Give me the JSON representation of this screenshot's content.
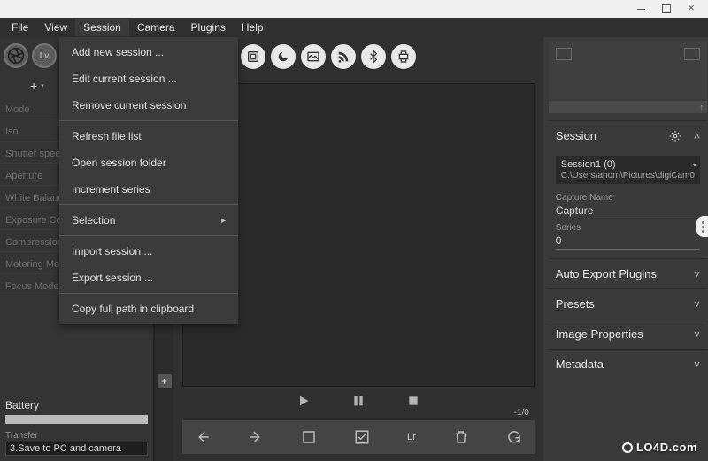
{
  "menubar": {
    "items": [
      "File",
      "View",
      "Session",
      "Camera",
      "Plugins",
      "Help"
    ],
    "active_index": 2
  },
  "dropdown": {
    "groups": [
      [
        "Add new session ...",
        "Edit current session ...",
        "Remove current session"
      ],
      [
        "Refresh file list",
        "Open session folder",
        "Increment series"
      ],
      [
        {
          "label": "Selection",
          "submenu": true
        }
      ],
      [
        "Import session ...",
        "Export session ..."
      ],
      [
        "Copy full path in clipboard"
      ]
    ]
  },
  "sidebar": {
    "lv_label": "Lv",
    "plus": "+",
    "settings": [
      {
        "label": "Mode"
      },
      {
        "label": "Iso"
      },
      {
        "label": "Shutter speed"
      },
      {
        "label": "Aperture"
      },
      {
        "label": "White Balance"
      },
      {
        "label": "Exposure Co"
      },
      {
        "label": "Compression"
      },
      {
        "label": "Metering Mode"
      },
      {
        "label": "Focus Mode"
      }
    ],
    "battery_label": "Battery",
    "transfer_label": "Transfer",
    "transfer_value": "3.Save to PC and camera"
  },
  "playback": {
    "counter": "-1/0"
  },
  "bottom": {
    "lr": "Lr"
  },
  "right": {
    "session_header": "Session",
    "session_name": "Session1",
    "session_count": "(0)",
    "session_path": "C:\\Users\\ahorn\\Pictures\\digiCam0",
    "capture_name_label": "Capture Name",
    "capture_name_value": "Capture",
    "series_label": "Series",
    "series_value": "0",
    "sections": [
      "Auto Export Plugins",
      "Presets",
      "Image Properties",
      "Metadata"
    ]
  },
  "watermark": "LO4D.com"
}
